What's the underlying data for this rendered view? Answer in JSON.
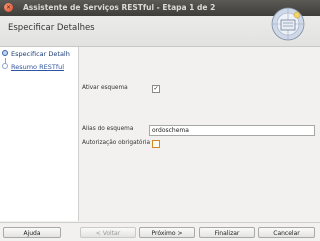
{
  "window": {
    "title": "Assistente de Serviços RESTful - Etapa 1 de 2"
  },
  "header": {
    "title": "Especificar Detalhes"
  },
  "steps": [
    {
      "label": "Especificar Detalh",
      "state": "current"
    },
    {
      "label": "Resumo RESTful",
      "state": "pending"
    }
  ],
  "form": {
    "enable_schema_label": "Ativar esquema",
    "enable_schema_checked": true,
    "schema_alias_label": "Alias do esquema",
    "schema_alias_value": "ordoschema",
    "auth_required_label": "Autorização obrigatória",
    "auth_required_checked": false
  },
  "footer": {
    "help": "Ajuda",
    "back": "< Voltar",
    "next": "Próximo >",
    "finish": "Finalizar",
    "cancel": "Cancelar"
  },
  "colors": {
    "titlebar": "#4a4945",
    "accent": "#3766a7",
    "required_checkbox_border": "#d18a26"
  }
}
